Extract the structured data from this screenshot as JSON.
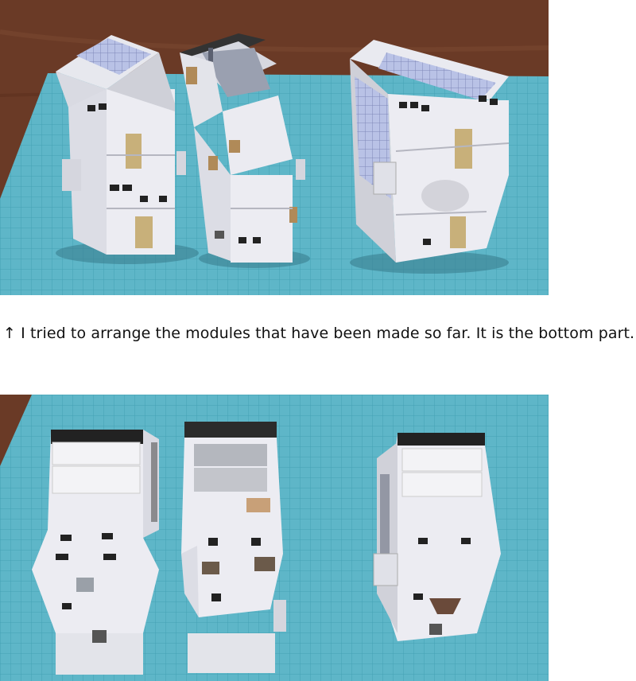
{
  "page": {
    "background": "#ffffff"
  },
  "photos": [
    {
      "subject": "three paper-craft space station modules, side view showing solar panel arrays",
      "colors": {
        "table": "#6b3a24",
        "mat": "#5fb7c9",
        "module": "#ecedf3",
        "panel": "#b8c1e4"
      }
    },
    {
      "subject": "three paper-craft space station modules, bottom ends facing camera",
      "colors": {
        "table": "#6b3a24",
        "mat": "#5fb7c9",
        "module": "#ecedf3"
      }
    }
  ],
  "caption": {
    "text": "↑ I tried to arrange the modules that have been made so far. It is the bottom part."
  }
}
